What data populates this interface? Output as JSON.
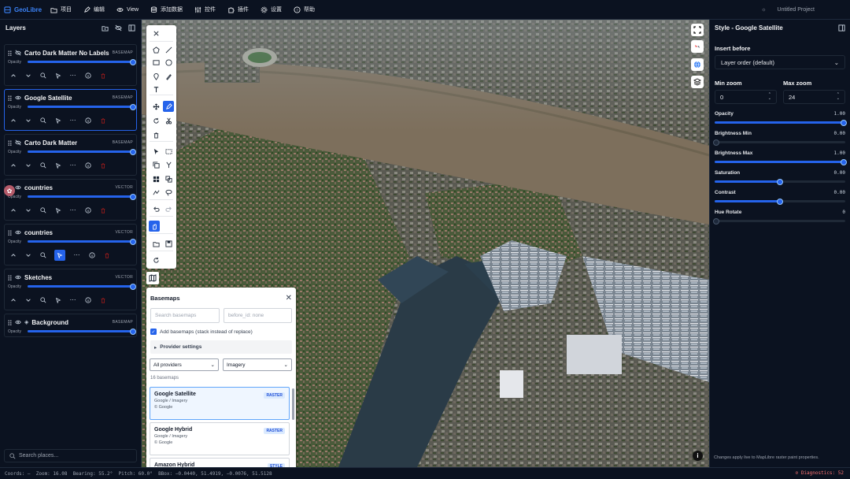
{
  "app": {
    "name": "GeoLibre",
    "project": "Untitled Project"
  },
  "menu": [
    {
      "label": "项目",
      "icon": "folder-icon"
    },
    {
      "label": "编辑",
      "icon": "pencil-icon"
    },
    {
      "label": "View",
      "icon": "eye-icon"
    },
    {
      "label": "添加数据",
      "icon": "database-icon"
    },
    {
      "label": "控件",
      "icon": "sliders-icon"
    },
    {
      "label": "插件",
      "icon": "puzzle-icon"
    },
    {
      "label": "设置",
      "icon": "gear-icon"
    },
    {
      "label": "帮助",
      "icon": "help-icon"
    }
  ],
  "layers_panel": {
    "title": "Layers",
    "opacity_label": "Opacity",
    "layers": [
      {
        "name": "Carto Dark Matter No Labels",
        "type": "BASEMAP",
        "opacity": 1.0,
        "visible": false,
        "active": false,
        "controls": true
      },
      {
        "name": "Google Satellite",
        "type": "BASEMAP",
        "opacity": 1.0,
        "visible": true,
        "active": true,
        "controls": true
      },
      {
        "name": "Carto Dark Matter",
        "type": "BASEMAP",
        "opacity": 1.0,
        "visible": false,
        "active": false,
        "controls": true
      },
      {
        "name": "countries",
        "type": "VECTOR",
        "opacity": 1.0,
        "visible": true,
        "active": false,
        "controls": true
      },
      {
        "name": "countries",
        "type": "VECTOR",
        "opacity": 1.0,
        "visible": true,
        "active": false,
        "controls": true,
        "tool_on": true
      },
      {
        "name": "Sketches",
        "type": "VECTOR",
        "opacity": 1.0,
        "visible": true,
        "active": false,
        "controls": true
      },
      {
        "name": "Background",
        "type": "BASEMAP",
        "opacity": 1.0,
        "visible": true,
        "active": false,
        "controls": false
      }
    ],
    "search_placeholder": "Search places..."
  },
  "basemaps": {
    "title": "Basemaps",
    "search_placeholder": "Search basemaps",
    "before_placeholder": "before_id: none",
    "add_label": "Add basemaps (stack instead of replace)",
    "provider_settings": "Provider settings",
    "provider_select": "All providers",
    "category_select": "Imagery",
    "count_label": "16 basemaps",
    "cards": [
      {
        "name": "Google Satellite",
        "sub": "Google / Imagery",
        "credit": "© Google",
        "badge": "RASTER",
        "selected": true
      },
      {
        "name": "Google Hybrid",
        "sub": "Google / Imagery",
        "credit": "© Google",
        "badge": "RASTER",
        "selected": false
      },
      {
        "name": "Amazon Hybrid",
        "sub": "",
        "credit": "",
        "badge": "STYLE",
        "selected": false
      }
    ]
  },
  "style_panel": {
    "title": "Style - Google Satellite",
    "insert_before_label": "Insert before",
    "insert_before_value": "Layer order (default)",
    "min_zoom_label": "Min zoom",
    "min_zoom": "0",
    "max_zoom_label": "Max zoom",
    "max_zoom": "24",
    "sliders": [
      {
        "label": "Opacity",
        "value": "1.00",
        "fraction": 1.0
      },
      {
        "label": "Brightness Min",
        "value": "0.00",
        "fraction": 0.0
      },
      {
        "label": "Brightness Max",
        "value": "1.00",
        "fraction": 1.0
      },
      {
        "label": "Saturation",
        "value": "0.00",
        "fraction": 0.5
      },
      {
        "label": "Contrast",
        "value": "0.00",
        "fraction": 0.5
      },
      {
        "label": "Hue Rotate",
        "value": "0",
        "fraction": 0.0
      }
    ],
    "note": "Changes apply live to MapLibre raster paint properties."
  },
  "status": {
    "text": "Coords: —  Zoom: 16.08  Bearing: 55.2°  Pitch: 60.0°  BBox: −0.0440, 51.4919, −0.0076, 51.5128",
    "diagnostics": "Diagnostics: 52"
  },
  "colors": {
    "accent": "#2563eb",
    "brand": "#3b82f6",
    "danger": "#f87171"
  }
}
